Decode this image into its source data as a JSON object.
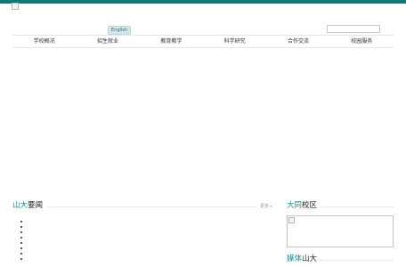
{
  "header": {
    "language_label": "English",
    "search": {
      "value": "",
      "placeholder": ""
    }
  },
  "nav": {
    "items": [
      {
        "label": "学校概况"
      },
      {
        "label": "招生就业"
      },
      {
        "label": "教育教学"
      },
      {
        "label": "科学研究"
      },
      {
        "label": "合作交流"
      },
      {
        "label": "校园服务"
      }
    ]
  },
  "news": {
    "title_accent": "山大",
    "title_rest": "要闻",
    "more_label": "更多",
    "more_arrow": "▸",
    "items": [
      "",
      "",
      "",
      "",
      "",
      "",
      "",
      ""
    ]
  },
  "campus": {
    "title_accent": "大同",
    "title_rest": "校区"
  },
  "media": {
    "title_accent": "媒体",
    "title_rest": "山大"
  },
  "colors": {
    "accent": "#0e8b92",
    "topbar": "#0e7a7c"
  }
}
